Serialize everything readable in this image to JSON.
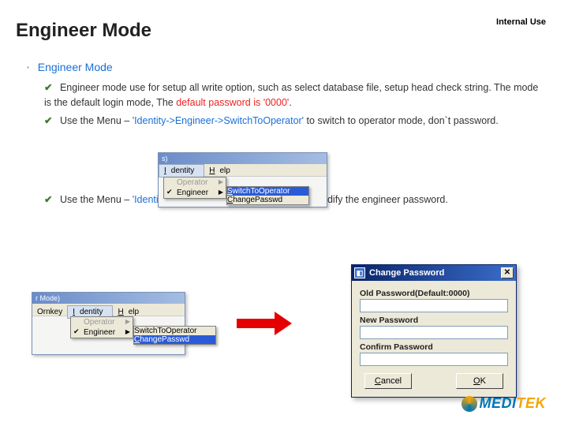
{
  "header": {
    "classification": "Internal Use",
    "title": "Engineer Mode"
  },
  "section": {
    "heading": "Engineer Mode"
  },
  "bullets": {
    "b1_pre": "Engineer mode use for setup all write option, such as select database file, setup head check string. The mode is the default login mode, The ",
    "b1_red": "default password is '0000'",
    "b1_post": ".",
    "b2_pre": "Use the Menu – ",
    "b2_path": "'Identity->Engineer->SwitchToOperator'",
    "b2_post": " to switch to operator mode, don`t password.",
    "b3_pre": "Use the Menu – ",
    "b3_path": "'Identity-> Engineer-> ChangePasswd'",
    "b3_post": " to modify the engineer password."
  },
  "ss1": {
    "titlefrag": "s)",
    "menu_identity_u": "I",
    "menu_identity_rest": "dentity",
    "menu_help_u": "H",
    "menu_help_rest": "elp",
    "dd_operator": "Operator",
    "dd_engineer": "Engineer",
    "sub_switch_u": "S",
    "sub_switch_rest": "witchToOperator",
    "sub_change_u": "C",
    "sub_change_rest": "hangePasswd"
  },
  "ss2": {
    "titlefrag": "r Mode)",
    "menu_ornkey": "Ornkey",
    "menu_identity_u": "I",
    "menu_identity_rest": "dentity",
    "menu_help_u": "H",
    "menu_help_rest": "elp",
    "dd_operator": "Operator",
    "dd_engineer": "Engineer",
    "sub_switch": "SwitchToOperator",
    "sub_change_u": "C",
    "sub_change_rest": "hangePasswd"
  },
  "dialog": {
    "title": "Change Password",
    "old_label": "Old Password(Default:0000)",
    "new_label": "New Password",
    "confirm_label": "Confirm Password",
    "cancel_u": "C",
    "cancel_rest": "ancel",
    "ok_u": "O",
    "ok_rest": "K"
  },
  "logo": {
    "part1": "MEDI",
    "part2": "TEK"
  }
}
